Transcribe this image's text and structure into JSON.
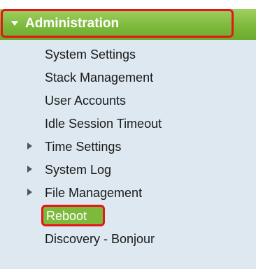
{
  "nav": {
    "section_title": "Administration",
    "items": [
      {
        "label": "System Settings",
        "expandable": false,
        "selected": false
      },
      {
        "label": "Stack Management",
        "expandable": false,
        "selected": false
      },
      {
        "label": "User Accounts",
        "expandable": false,
        "selected": false
      },
      {
        "label": "Idle Session Timeout",
        "expandable": false,
        "selected": false
      },
      {
        "label": "Time Settings",
        "expandable": true,
        "selected": false
      },
      {
        "label": "System Log",
        "expandable": true,
        "selected": false
      },
      {
        "label": "File Management",
        "expandable": true,
        "selected": false
      },
      {
        "label": "Reboot",
        "expandable": false,
        "selected": true
      },
      {
        "label": "Discovery - Bonjour",
        "expandable": false,
        "selected": false
      }
    ]
  },
  "colors": {
    "panel_background": "#dde8f0",
    "header_green": "#7dba3c",
    "highlight_red": "#e8141b",
    "text": "#1a1a1a"
  },
  "icons": {
    "section_toggle": "triangle-down-icon",
    "expand": "triangle-right-icon"
  }
}
